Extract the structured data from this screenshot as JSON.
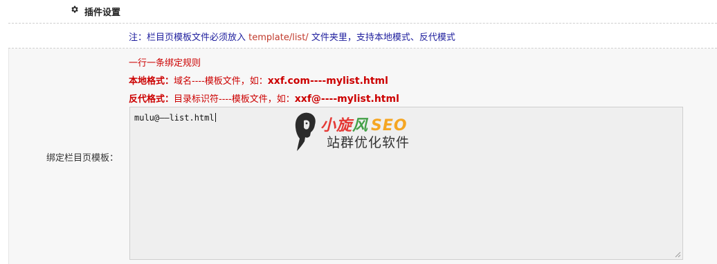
{
  "section": {
    "icon": "gear-icon",
    "title": "插件设置"
  },
  "note": {
    "prefix": "注：栏目页模板文件必须放入 ",
    "path": "template/list/",
    "suffix": " 文件夹里，支持本地模式、反代模式"
  },
  "field": {
    "label": "绑定栏目页模板：",
    "hint_line1": "一行一条绑定规则",
    "hint_local_label": "本地格式：",
    "hint_local_text": "域名----模板文件，如：",
    "hint_local_example": "xxf.com----mylist.html",
    "hint_proxy_label": "反代格式：",
    "hint_proxy_text": "目录标识符----模板文件，如：",
    "hint_proxy_example": "xxf@----mylist.html",
    "value": "mulu@——list.html"
  },
  "watermark": {
    "title_chars": [
      "小",
      "旋",
      "风",
      "SEO"
    ],
    "subtitle": "站群优化软件"
  },
  "colors": {
    "note_blue": "#1f1f9e",
    "hint_red": "#cc0000",
    "textarea_bg": "#efefef",
    "row_bg": "#f7f7f7"
  }
}
